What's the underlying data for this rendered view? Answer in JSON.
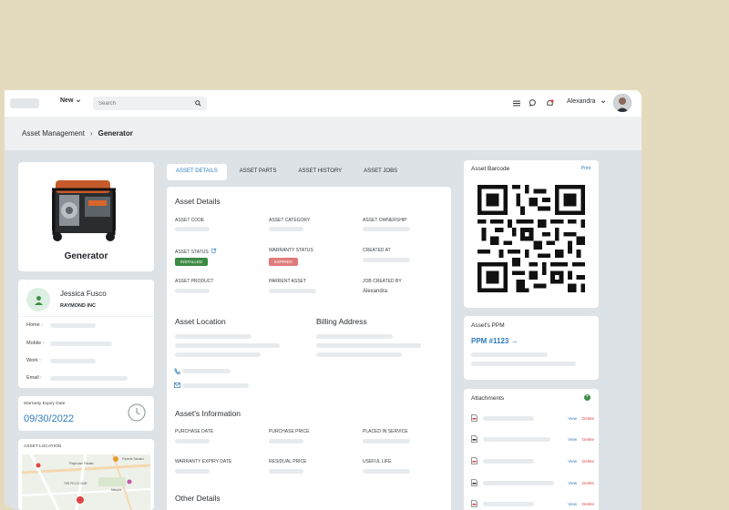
{
  "topbar": {
    "new_label": "New",
    "search_placeholder": "Search",
    "user_name": "Alexandra"
  },
  "breadcrumb": {
    "root": "Asset Management",
    "current": "Generator"
  },
  "asset": {
    "name": "Generator"
  },
  "contact": {
    "name": "Jessica Fusco",
    "company": "RAYMOND INC",
    "fields": [
      "Home :",
      "Mobile :",
      "Work :",
      "Email :"
    ]
  },
  "warranty": {
    "label": "Warranty Expiry Date",
    "date": "09/30/2022"
  },
  "location_card": {
    "label": "ASSET LOCATION"
  },
  "tabs": [
    "ASSET DETAILS",
    "ASSET PARTS",
    "ASSET HISTORY",
    "ASSET JOBS"
  ],
  "details": {
    "title": "Asset Details",
    "asset_code": "ASSET CODE",
    "asset_category": "ASSET CATEGORY",
    "asset_ownership": "ASSET OWNERSHIP",
    "asset_status": "ASSET STATUS",
    "warranty_status": "WARRANTY STATUS",
    "created_at": "CREATED AT",
    "status_value": "INSTALLED",
    "warranty_value": "EXPIRED",
    "asset_product": "ASSET PRODUCT",
    "parent_asset": "PARRENT ASSET",
    "job_created_by": "JOB CREATED BY",
    "job_created_by_value": "Alexandra"
  },
  "location": {
    "title": "Asset Location",
    "billing_title": "Billing Address"
  },
  "info": {
    "title": "Asset's Information",
    "purchase_date": "PURCHASE DATE",
    "purchase_price": "PURCHASE PRICE",
    "placed_in_service": "PLACED IN SERVICE",
    "warranty_expiry_date": "WARRANTY EXPIRY DATE",
    "residual_price": "RESIDUAL PRICE",
    "useful_life": "USEFUL LIFE"
  },
  "other": {
    "title": "Other Details"
  },
  "barcode": {
    "title": "Asset Barcode",
    "print_label": "Print"
  },
  "ppm": {
    "title": "Asset's PPM",
    "link": "PPM #1123 →"
  },
  "attachments": {
    "title": "Attachments",
    "view_label": "View",
    "delete_label": "Delete"
  },
  "map": {
    "labels": [
      "Pizzeria Toscano",
      "Playhouse Theater",
      "Marquis",
      "THE PICCO VINE"
    ]
  },
  "colors": {
    "accent": "#2e7bbd",
    "installed": "#3c8b45",
    "expired": "#e07b7b",
    "avatar": "#dcefe2"
  }
}
